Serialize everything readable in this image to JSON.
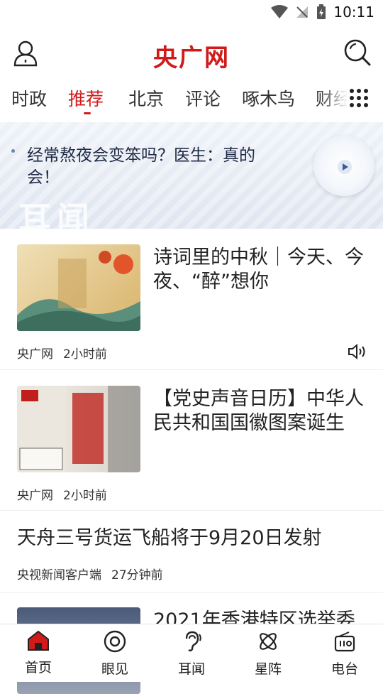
{
  "status_bar": {
    "time": "10:11"
  },
  "header": {
    "logo": "央广网"
  },
  "tabs": [
    "时政",
    "推荐",
    "北京",
    "评论",
    "啄木鸟",
    "财经"
  ],
  "active_tab": "推荐",
  "banner": {
    "text": "经常熬夜会变笨吗？医生：真的会！",
    "watermark": "耳闻"
  },
  "feed": [
    {
      "title": "诗词里的中秋｜今天、今夜、“醉”想你",
      "source": "央广网",
      "time": "2小时前",
      "has_audio": true
    },
    {
      "title": "【党史声音日历】中华人民共和国国徽图案诞生",
      "source": "央广网",
      "time": "2小时前",
      "has_audio": false
    },
    {
      "title": "天舟三号货运飞船将于9月20日发射",
      "source": "央视新闻客户端",
      "time": "27分钟前",
      "has_audio": false
    },
    {
      "title": "2021年香港特区选举委",
      "source": "",
      "time": "",
      "has_audio": false
    }
  ],
  "bottom_nav": [
    {
      "label": "首页",
      "icon": "home-icon",
      "active": true
    },
    {
      "label": "眼见",
      "icon": "eye-icon",
      "active": false
    },
    {
      "label": "耳闻",
      "icon": "ear-icon",
      "active": false
    },
    {
      "label": "星阵",
      "icon": "atom-icon",
      "active": false
    },
    {
      "label": "电台",
      "icon": "radio-icon",
      "active": false
    }
  ],
  "colors": {
    "brand": "#d11a1a",
    "text": "#222222",
    "banner_bg": "#e3e9f3"
  }
}
